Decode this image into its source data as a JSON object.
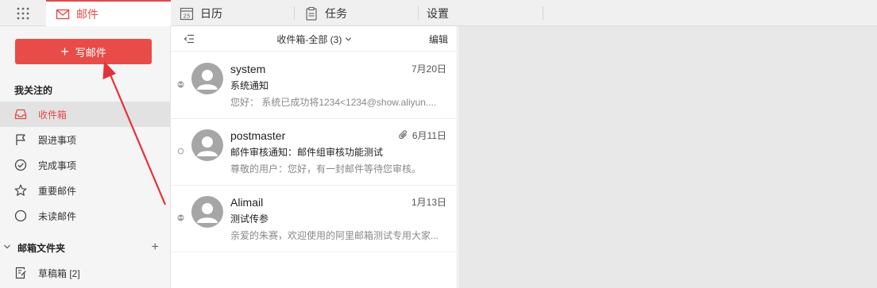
{
  "topnav": {
    "tabs": [
      {
        "label": "邮件",
        "icon": "mail-icon"
      },
      {
        "label": "日历",
        "icon": "calendar-icon",
        "calendar_day": "25"
      },
      {
        "label": "任务",
        "icon": "clipboard-icon"
      },
      {
        "label": "设置"
      }
    ]
  },
  "sidebar": {
    "compose_label": "写邮件",
    "followed_title": "我关注的",
    "items": [
      {
        "label": "收件箱",
        "icon": "inbox-icon",
        "active": true
      },
      {
        "label": "跟进事项",
        "icon": "flag-icon"
      },
      {
        "label": "完成事项",
        "icon": "check-circle-icon"
      },
      {
        "label": "重要邮件",
        "icon": "star-icon"
      },
      {
        "label": "未读邮件",
        "icon": "circle-icon"
      }
    ],
    "folders_title": "邮箱文件夹",
    "folders": [
      {
        "label": "草稿箱 [2]",
        "icon": "draft-icon"
      }
    ]
  },
  "list": {
    "folder_label": "收件箱-全部 (3)",
    "edit_label": "编辑",
    "messages": [
      {
        "from": "system",
        "date": "7月20日",
        "subject": "系统通知",
        "preview": "您好： 系统已成功将1234<1234@show.aliyun....",
        "status": "read",
        "attachment": false
      },
      {
        "from": "postmaster",
        "date": "6月11日",
        "subject": "邮件审核通知：邮件组审核功能测试",
        "preview": "尊敬的用户：您好，有一封邮件等待您审核。",
        "status": "unread",
        "attachment": true
      },
      {
        "from": "Alimail",
        "date": "1月13日",
        "subject": "测试传参",
        "preview": "亲爱的朱赛，欢迎使用的阿里邮箱测试专用大家...",
        "status": "read",
        "attachment": false
      }
    ]
  },
  "colors": {
    "accent": "#e34b4b",
    "compose_bg": "#e94c48",
    "reader_bg": "#e8e8e8",
    "annotation_arrow": "#e5323a"
  }
}
